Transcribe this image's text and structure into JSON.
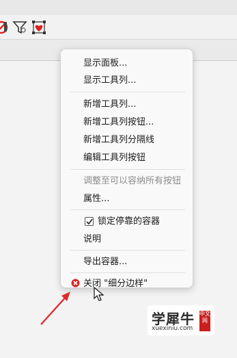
{
  "menu": {
    "items": [
      {
        "label": "显示面板...",
        "enabled": true
      },
      {
        "label": "显示工具列...",
        "enabled": true
      },
      {
        "label": "新增工具列...",
        "enabled": true
      },
      {
        "label": "新增工具列按钮...",
        "enabled": true
      },
      {
        "label": "新增工具列分隔线",
        "enabled": true
      },
      {
        "label": "编辑工具列按钮",
        "enabled": true
      },
      {
        "label": "调整至可以容纳所有按钮",
        "enabled": false
      },
      {
        "label": "属性...",
        "enabled": true
      },
      {
        "label": "锁定停靠的容器",
        "enabled": true,
        "checked": true
      },
      {
        "label": "说明",
        "enabled": true
      },
      {
        "label": "导出容器...",
        "enabled": true
      },
      {
        "label": "关闭 \"细分边样\"",
        "enabled": true
      }
    ]
  },
  "toolbar": {
    "icons": [
      "red-circle-slash-icon",
      "funnel-filter-icon",
      "mesh-heart-icon"
    ]
  },
  "watermark": {
    "title": "学犀牛",
    "url": "xuexiniu.com",
    "badge": "中文网"
  },
  "colors": {
    "arrow": "#e02a2a",
    "close_icon": "#d42b2b"
  }
}
